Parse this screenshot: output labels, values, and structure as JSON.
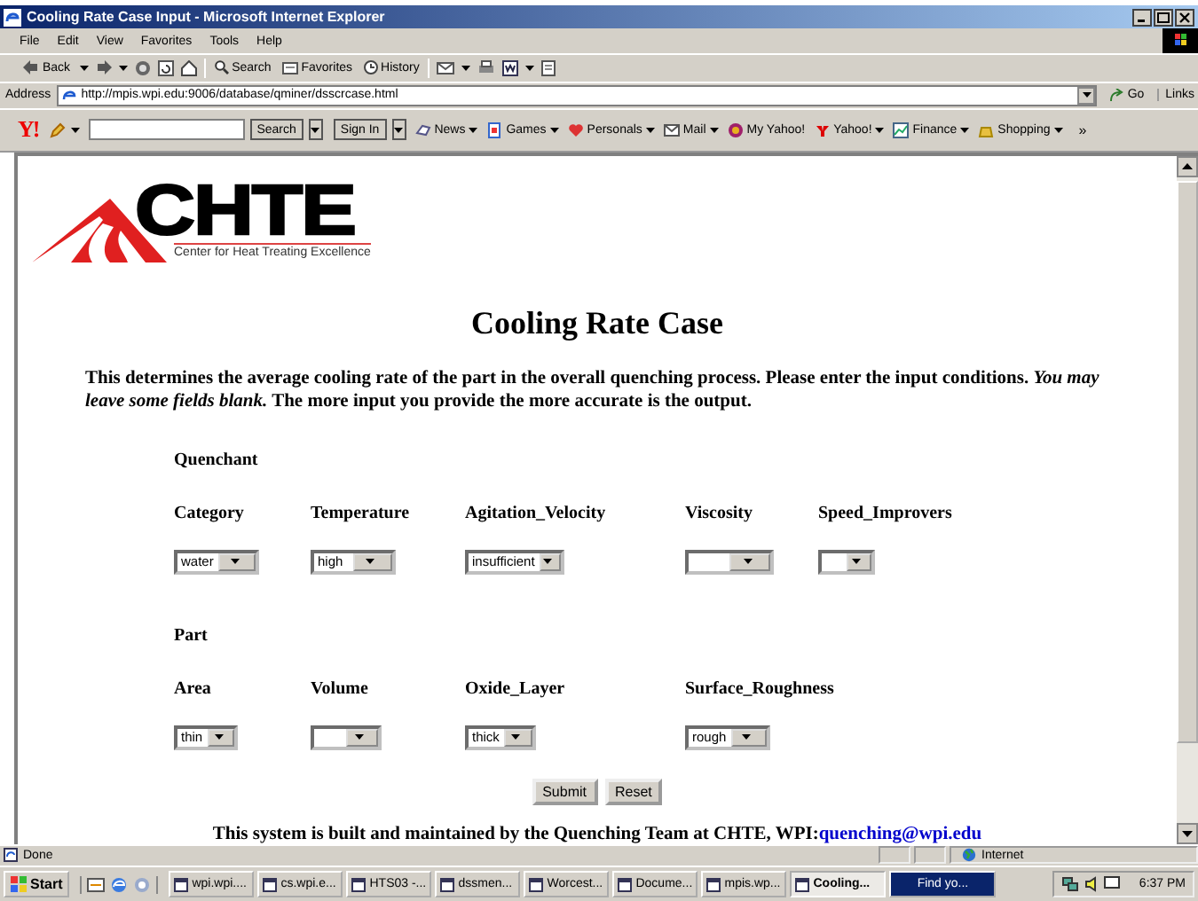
{
  "window": {
    "title": "Cooling Rate Case Input - Microsoft Internet Explorer"
  },
  "menu": [
    "File",
    "Edit",
    "View",
    "Favorites",
    "Tools",
    "Help"
  ],
  "toolbar": {
    "back": "Back",
    "search": "Search",
    "favorites": "Favorites",
    "history": "History"
  },
  "address": {
    "label": "Address",
    "value": "http://mpis.wpi.edu:9006/database/qminer/dsscrcase.html",
    "go": "Go",
    "links": "Links"
  },
  "yahoo_bar": {
    "logo": "Y!",
    "search": "Search",
    "sign_in": "Sign In",
    "more": "»",
    "items": [
      {
        "label": "News",
        "menu": true
      },
      {
        "label": "Games",
        "menu": true
      },
      {
        "label": "Personals",
        "menu": true
      },
      {
        "label": "Mail",
        "menu": true
      },
      {
        "label": "My Yahoo!",
        "menu": false
      },
      {
        "label": "Yahoo!",
        "menu": true
      },
      {
        "label": "Finance",
        "menu": true
      },
      {
        "label": "Shopping",
        "menu": true
      }
    ]
  },
  "page": {
    "logo": {
      "title": "CHTE",
      "subtitle": "Center for Heat Treating Excellence"
    },
    "heading": "Cooling Rate Case",
    "intro": "This determines the average cooling rate of the part in the overall quenching process. Please enter the input conditions. *You may leave some fields blank.* The more input you provide the more accurate is the output.",
    "sections": [
      {
        "title": "Quenchant",
        "fields": [
          {
            "label": "Category",
            "value": "water"
          },
          {
            "label": "Temperature",
            "value": "high"
          },
          {
            "label": "Agitation_Velocity",
            "value": "insufficient"
          },
          {
            "label": "Viscosity"
          },
          {
            "label": "Speed_Improvers"
          }
        ]
      },
      {
        "title": "Part",
        "fields": [
          {
            "label": "Area",
            "value": "thin"
          },
          {
            "label": "Volume"
          },
          {
            "label": "Oxide_Layer",
            "value": "thick"
          },
          {
            "label": "Surface_Roughness",
            "value": "rough"
          }
        ]
      }
    ],
    "buttons": [
      "Submit",
      "Reset"
    ],
    "footer": {
      "text": "This system is built and maintained by the Quenching Team at CHTE, WPI:",
      "link": "quenching@wpi.edu"
    }
  },
  "status_bar": {
    "text": "Done",
    "zone": "Internet"
  },
  "taskbar": {
    "start": "Start",
    "tasks": [
      {
        "label": "wpi.wpi....",
        "selected": false,
        "flashing": false
      },
      {
        "label": "cs.wpi.e...",
        "selected": false,
        "flashing": false
      },
      {
        "label": "HTS03 -...",
        "selected": false,
        "flashing": false
      },
      {
        "label": "dssmen...",
        "selected": false,
        "flashing": false
      },
      {
        "label": "Worcest...",
        "selected": false,
        "flashing": false
      },
      {
        "label": "Docume...",
        "selected": false,
        "flashing": false
      },
      {
        "label": "mpis.wp...",
        "selected": false,
        "flashing": false
      },
      {
        "label": "Cooling...",
        "selected": true,
        "flashing": false
      },
      {
        "label": "Find yo...",
        "selected": false,
        "flashing": true
      }
    ],
    "clock": "6:37 PM"
  }
}
